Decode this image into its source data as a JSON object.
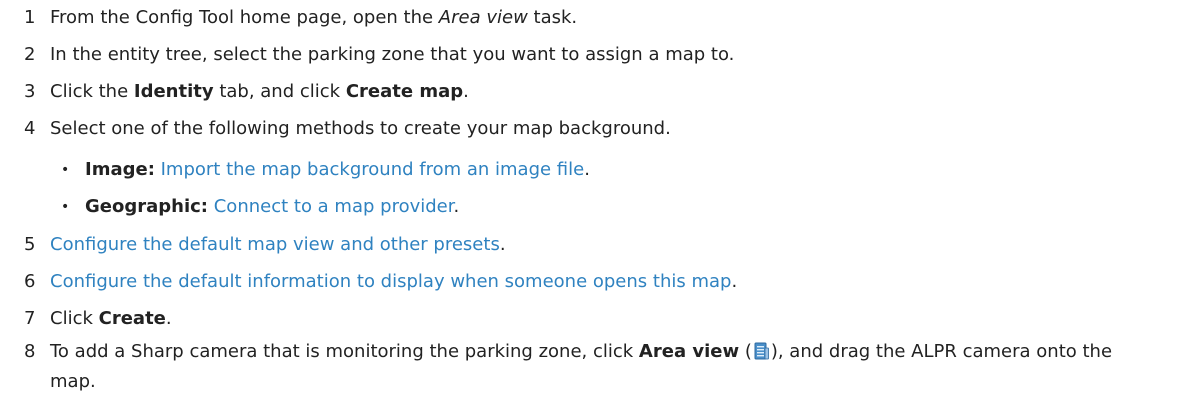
{
  "steps": [
    {
      "number": "1",
      "pre": "From the Config Tool home page, open the ",
      "italic": "Area view",
      "post": " task."
    },
    {
      "number": "2",
      "text": "In the entity tree, select the parking zone that you want to assign a map to."
    },
    {
      "number": "3",
      "pre": "Click the ",
      "bold1": "Identity",
      "mid": " tab, and click ",
      "bold2": "Create map",
      "post": "."
    },
    {
      "number": "4",
      "text": "Select one of the following methods to create your map background."
    },
    {
      "number": "5",
      "link": "Configure the default map view and other presets",
      "post": "."
    },
    {
      "number": "6",
      "link": "Configure the default information to display when someone opens this map",
      "post": "."
    },
    {
      "number": "7",
      "pre": "Click ",
      "bold": "Create",
      "post": "."
    },
    {
      "number": "8",
      "pre": "To add a Sharp camera that is monitoring the parking zone, click ",
      "bold": "Area view",
      "mid": " (",
      "post": "), and drag the ALPR camera onto the map."
    }
  ],
  "methods": [
    {
      "bullet": "•",
      "label": "Image:",
      "link": "Import the map background from an image file",
      "post": "."
    },
    {
      "bullet": "•",
      "label": "Geographic:",
      "link": "Connect to a map provider",
      "post": "."
    }
  ],
  "icons": {
    "area_view": "area-view-icon"
  },
  "colors": {
    "text": "#222222",
    "link": "#2f82c0"
  }
}
